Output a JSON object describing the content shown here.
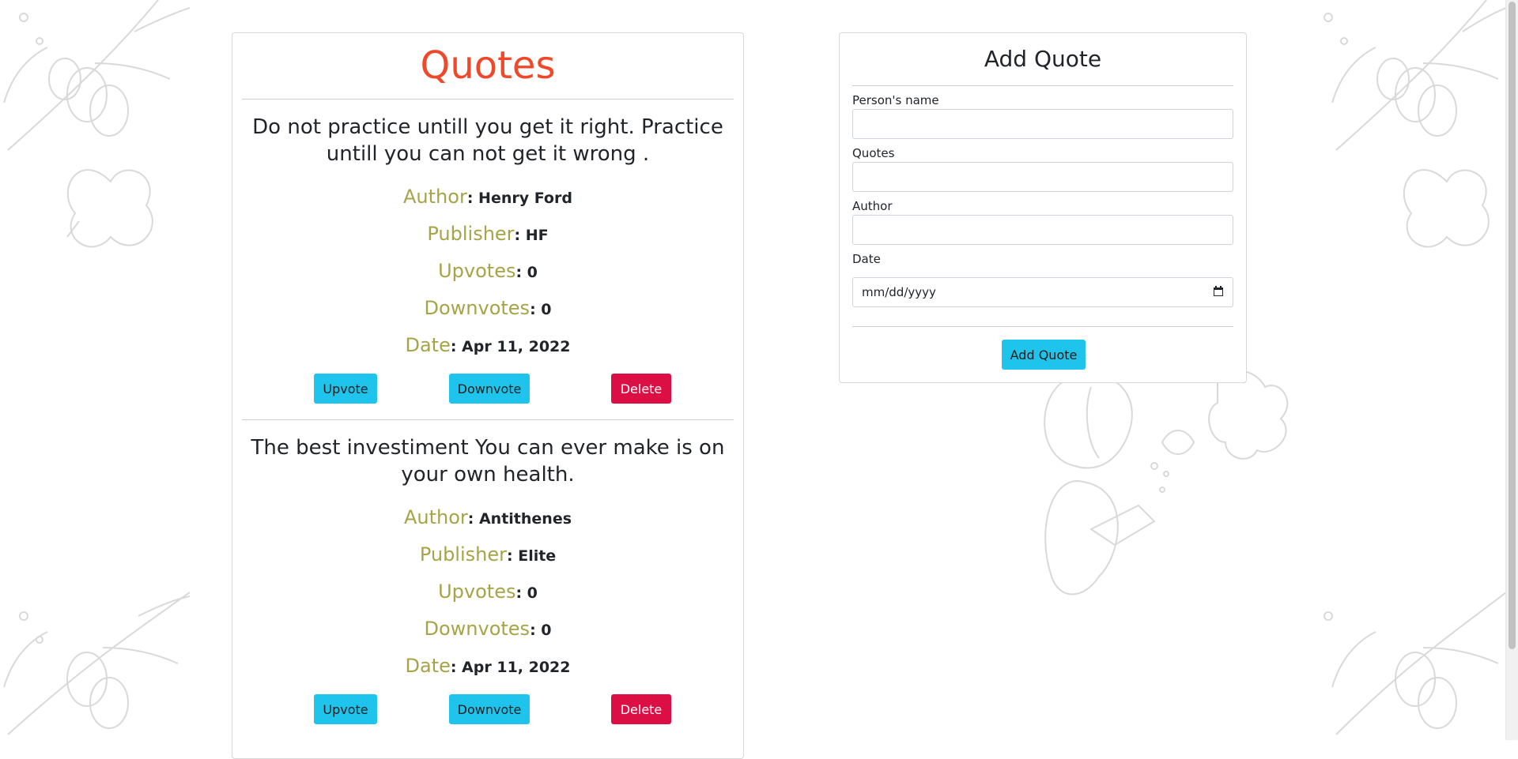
{
  "quotes_section": {
    "title": "Quotes",
    "items": [
      {
        "text": "Do not practice untill you get it right. Practice untill you can not get it wrong .",
        "author_label": "Author",
        "author": ": Henry Ford",
        "publisher_label": "Publisher",
        "publisher": ": HF",
        "upvotes_label": "Upvotes",
        "upvotes": ": 0",
        "downvotes_label": "Downvotes",
        "downvotes": ": 0",
        "date_label": "Date",
        "date": ": Apr 11, 2022",
        "upvote_btn": "Upvote",
        "downvote_btn": "Downvote",
        "delete_btn": "Delete"
      },
      {
        "text": "The best investiment You can ever make is on your own health.",
        "author_label": "Author",
        "author": ": Antithenes",
        "publisher_label": "Publisher",
        "publisher": ": Elite",
        "upvotes_label": "Upvotes",
        "upvotes": ": 0",
        "downvotes_label": "Downvotes",
        "downvotes": ": 0",
        "date_label": "Date",
        "date": ": Apr 11, 2022",
        "upvote_btn": "Upvote",
        "downvote_btn": "Downvote",
        "delete_btn": "Delete"
      }
    ]
  },
  "add_form": {
    "title": "Add Quote",
    "name_label": "Person's name",
    "name_value": "",
    "quote_label": "Quotes",
    "quote_value": "",
    "author_label": "Author",
    "author_value": "",
    "date_label": "Date",
    "date_placeholder": "mm/dd/yyyy",
    "submit_label": "Add Quote"
  },
  "colors": {
    "title_accent": "#f0492a",
    "field_label": "#a6a447",
    "info_button": "#1ec4ec",
    "danger_button": "#dc0f45"
  },
  "icons": {
    "calendar": "calendar-icon"
  }
}
